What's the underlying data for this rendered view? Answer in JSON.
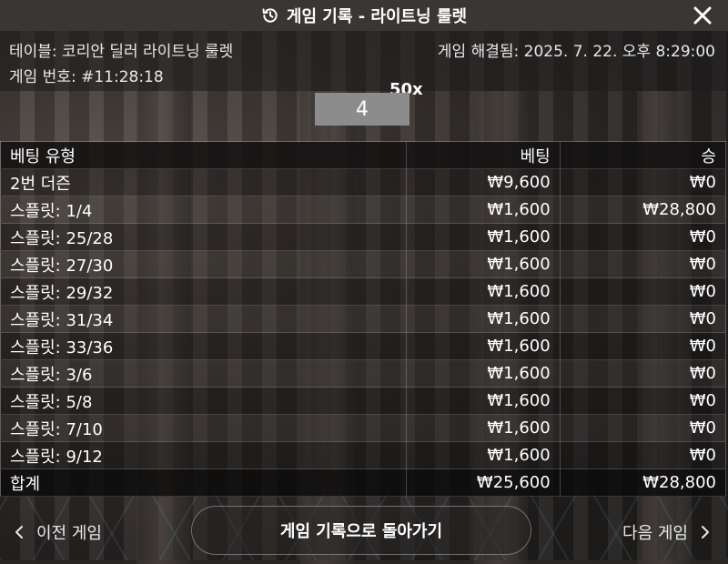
{
  "header": {
    "title": "게임 기록 - 라이트닝 룰렛"
  },
  "info": {
    "table": "테이블: 코리안 딜러 라이트닝 룰렛",
    "game_number": "게임 번호: #11:28:18",
    "resolved": "게임 해결됨: 2025. 7. 22. 오후 8:29:00"
  },
  "result": {
    "number": "4",
    "multiplier": "50x"
  },
  "bets_table": {
    "columns": [
      "베팅 유형",
      "베팅",
      "승"
    ],
    "rows": [
      {
        "type": "2번 더즌",
        "bet": "₩9,600",
        "win": "₩0"
      },
      {
        "type": "스플릿: 1/4",
        "bet": "₩1,600",
        "win": "₩28,800"
      },
      {
        "type": "스플릿: 25/28",
        "bet": "₩1,600",
        "win": "₩0"
      },
      {
        "type": "스플릿: 27/30",
        "bet": "₩1,600",
        "win": "₩0"
      },
      {
        "type": "스플릿: 29/32",
        "bet": "₩1,600",
        "win": "₩0"
      },
      {
        "type": "스플릿: 31/34",
        "bet": "₩1,600",
        "win": "₩0"
      },
      {
        "type": "스플릿: 33/36",
        "bet": "₩1,600",
        "win": "₩0"
      },
      {
        "type": "스플릿: 3/6",
        "bet": "₩1,600",
        "win": "₩0"
      },
      {
        "type": "스플릿: 5/8",
        "bet": "₩1,600",
        "win": "₩0"
      },
      {
        "type": "스플릿: 7/10",
        "bet": "₩1,600",
        "win": "₩0"
      },
      {
        "type": "스플릿: 9/12",
        "bet": "₩1,600",
        "win": "₩0"
      }
    ],
    "total": {
      "label": "합계",
      "bet": "₩25,600",
      "win": "₩28,800"
    }
  },
  "footer": {
    "prev_label": "이전 게임",
    "back_label": "게임 기록으로 돌아가기",
    "next_label": "다음 게임"
  },
  "icons": {
    "title": "history-icon",
    "close": "close-icon",
    "prev": "chevron-left-icon",
    "next": "chevron-right-icon"
  }
}
